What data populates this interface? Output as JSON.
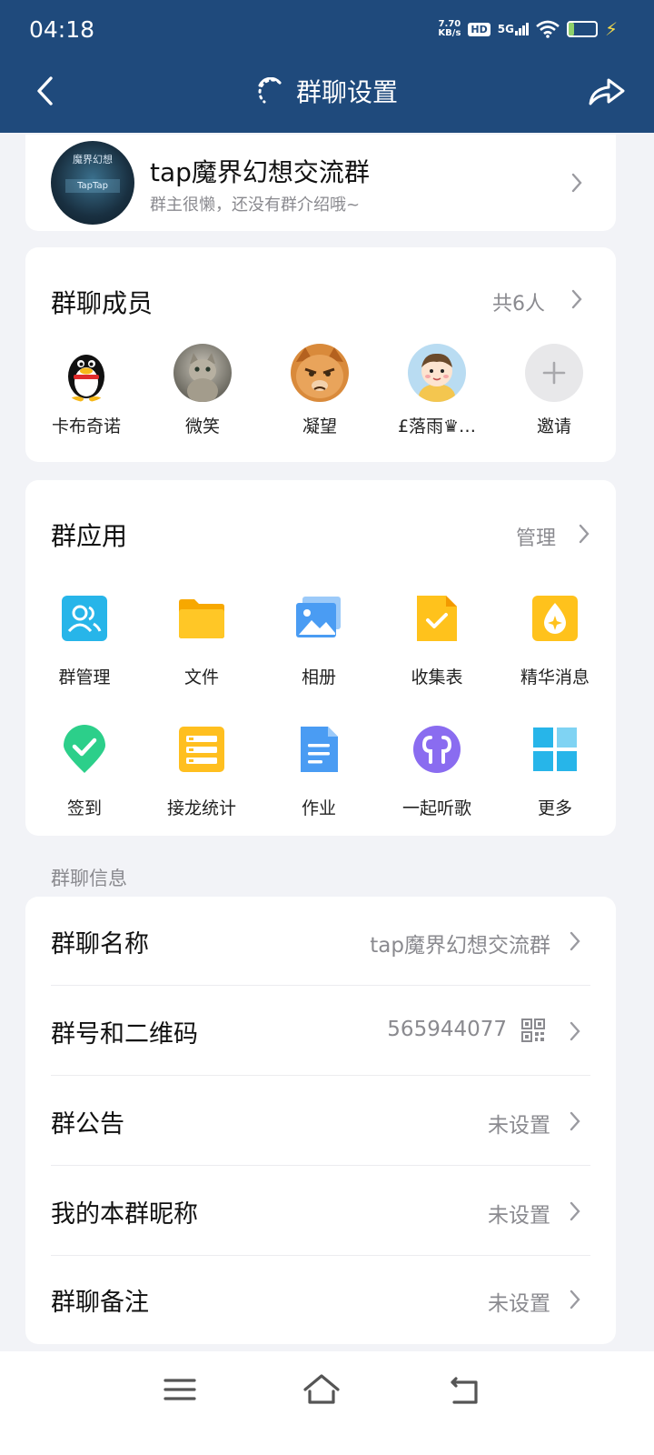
{
  "status": {
    "time": "04:18",
    "net_speed_value": "7.70",
    "net_speed_unit": "KB/s",
    "hd": "HD",
    "network": "5G",
    "battery": "21",
    "battery_level": 0.21
  },
  "nav": {
    "title": "群聊设置"
  },
  "group": {
    "avatar_text_top": "魔界幻想",
    "avatar_text_mid": "TapTap",
    "name": "tap魔界幻想交流群",
    "intro": "群主很懒，还没有群介绍哦~"
  },
  "members": {
    "title": "群聊成员",
    "count_label": "共6人",
    "list": [
      {
        "name": "卡布奇诺",
        "avatar": "penguin-avatar"
      },
      {
        "name": "微笑",
        "avatar": "cat-avatar"
      },
      {
        "name": "凝望",
        "avatar": "grumpy-cat-avatar"
      },
      {
        "name": "£落雨♛…",
        "avatar": "cartoon-boy-avatar"
      },
      {
        "name": "邀请",
        "avatar": "plus-icon"
      }
    ]
  },
  "apps": {
    "title": "群应用",
    "manage_label": "管理",
    "items": [
      {
        "name": "群管理",
        "icon": "group-manage-icon",
        "color": "#27b5e9"
      },
      {
        "name": "文件",
        "icon": "folder-icon",
        "color": "#ffbf1f"
      },
      {
        "name": "相册",
        "icon": "photo-album-icon",
        "color": "#4a9cf3"
      },
      {
        "name": "收集表",
        "icon": "form-icon",
        "color": "#ffc21c"
      },
      {
        "name": "精华消息",
        "icon": "essence-icon",
        "color": "#ffc21c"
      },
      {
        "name": "签到",
        "icon": "checkin-icon",
        "color": "#2ccf8a"
      },
      {
        "name": "接龙统计",
        "icon": "chain-stats-icon",
        "color": "#ffbf1f"
      },
      {
        "name": "作业",
        "icon": "homework-icon",
        "color": "#4a9cf3"
      },
      {
        "name": "一起听歌",
        "icon": "listen-together-icon",
        "color": "#8a6cf0"
      },
      {
        "name": "更多",
        "icon": "more-apps-icon",
        "color": "#27b5e9"
      }
    ]
  },
  "info": {
    "caption": "群聊信息",
    "rows": [
      {
        "label": "群聊名称",
        "value": "tap魔界幻想交流群"
      },
      {
        "label": "群号和二维码",
        "value": "565944077"
      },
      {
        "label": "群公告",
        "value": "未设置"
      },
      {
        "label": "我的本群昵称",
        "value": "未设置"
      },
      {
        "label": "群聊备注",
        "value": "未设置"
      }
    ]
  }
}
